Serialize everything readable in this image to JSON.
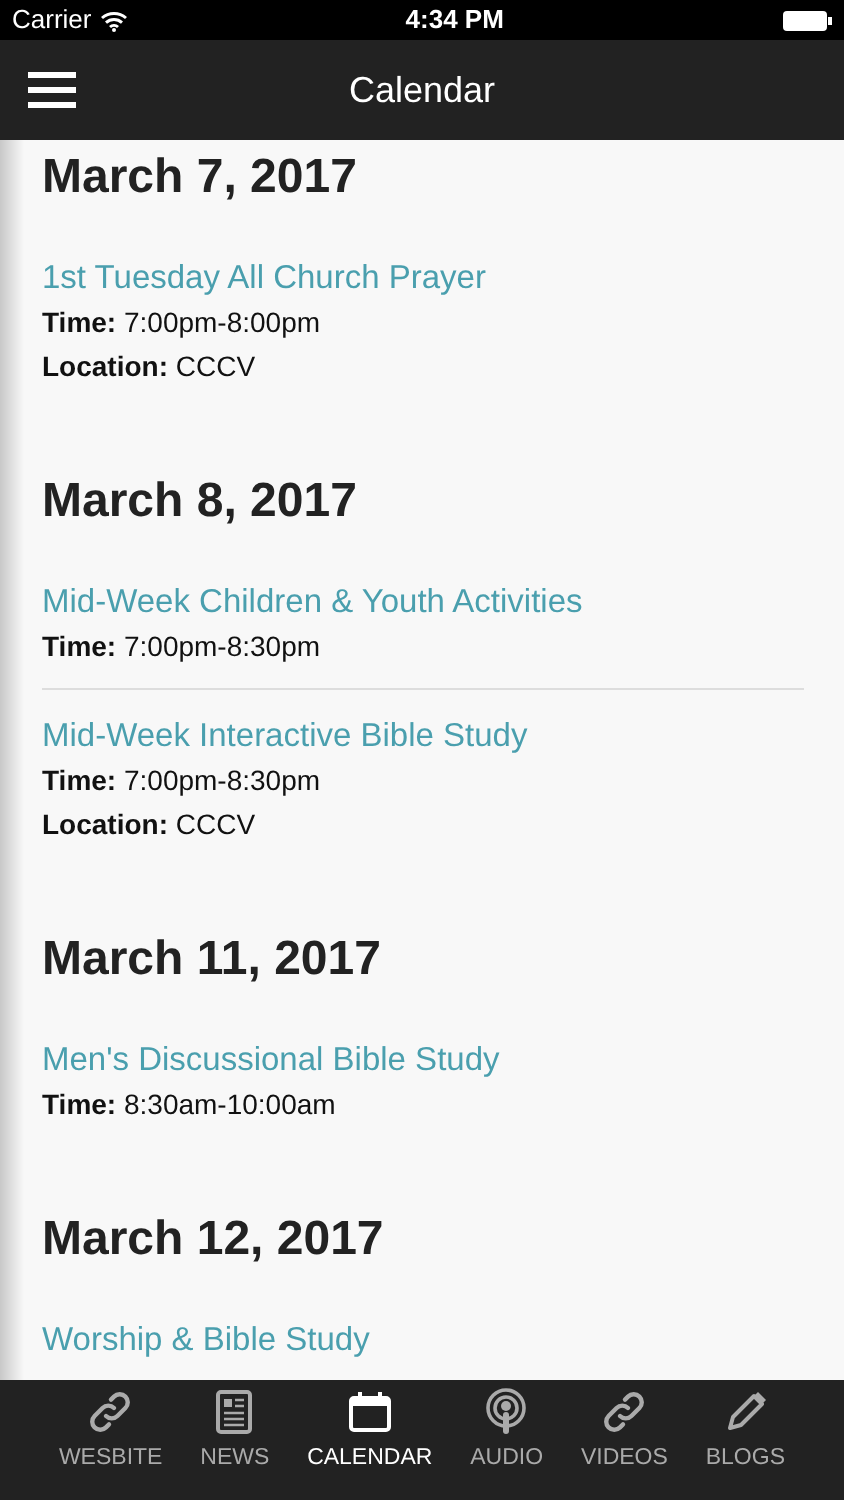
{
  "status_bar": {
    "carrier": "Carrier",
    "time": "4:34 PM"
  },
  "header": {
    "title": "Calendar"
  },
  "days": [
    {
      "date": "March 7, 2017",
      "events": [
        {
          "title": "1st Tuesday All Church Prayer",
          "details": [
            {
              "label": "Time:",
              "value": "7:00pm-8:00pm"
            },
            {
              "label": "Location:",
              "value": "CCCV"
            }
          ]
        }
      ]
    },
    {
      "date": "March 8, 2017",
      "events": [
        {
          "title": "Mid-Week Children & Youth Activities",
          "details": [
            {
              "label": "Time:",
              "value": "7:00pm-8:30pm"
            }
          ]
        },
        {
          "title": "Mid-Week Interactive Bible Study",
          "details": [
            {
              "label": "Time:",
              "value": "7:00pm-8:30pm"
            },
            {
              "label": "Location:",
              "value": "CCCV"
            }
          ]
        }
      ]
    },
    {
      "date": "March 11, 2017",
      "events": [
        {
          "title": "Men's Discussional Bible Study",
          "details": [
            {
              "label": "Time:",
              "value": "8:30am-10:00am"
            }
          ]
        }
      ]
    },
    {
      "date": "March 12, 2017",
      "events": [
        {
          "title": "Worship & Bible Study"
        }
      ]
    }
  ],
  "tabs": [
    {
      "label": "WESBITE",
      "kind": "link",
      "selected": false
    },
    {
      "label": "NEWS",
      "kind": "news",
      "selected": false
    },
    {
      "label": "CALENDAR",
      "kind": "calendar",
      "selected": true
    },
    {
      "label": "AUDIO",
      "kind": "podcast",
      "selected": false
    },
    {
      "label": "VIDEOS",
      "kind": "link",
      "selected": false
    },
    {
      "label": "BLOGS",
      "kind": "pencil",
      "selected": false
    }
  ]
}
